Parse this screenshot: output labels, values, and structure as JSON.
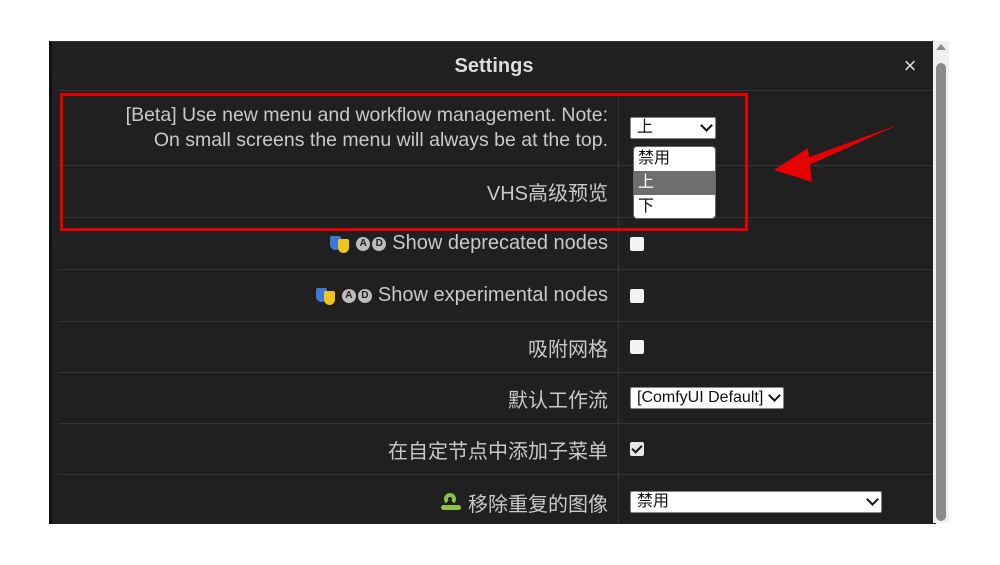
{
  "dialog": {
    "title": "Settings",
    "close_label": "×"
  },
  "rows": [
    {
      "label": "[Beta] Use new menu and workflow management. Note:\nOn small screens the menu will always be at the top.",
      "control": "select",
      "value": "上"
    },
    {
      "label": "VHS高级预览",
      "control": "none"
    },
    {
      "label": "Show deprecated nodes",
      "icon_badges": [
        "A",
        "D"
      ],
      "icon": "theater-masks-icon",
      "control": "checkbox",
      "checked": false
    },
    {
      "label": "Show experimental nodes",
      "icon_badges": [
        "A",
        "D"
      ],
      "icon": "theater-masks-icon",
      "control": "checkbox",
      "checked": false
    },
    {
      "label": "吸附网格",
      "control": "checkbox",
      "checked": false
    },
    {
      "label": "默认工作流",
      "control": "select",
      "value": "[ComfyUI Default]"
    },
    {
      "label": "在自定节点中添加子菜单",
      "control": "checkbox",
      "checked": true
    },
    {
      "label": "移除重复的图像",
      "icon": "snake-icon",
      "control": "select",
      "value": "禁用"
    }
  ],
  "dropdown_options": [
    "禁用",
    "上",
    "下"
  ],
  "dropdown_selected": "上",
  "colors": {
    "dialog_bg": "#202020",
    "text": "#c9c9c9",
    "highlight_box": "#e60000",
    "arrow": "#e60000"
  }
}
